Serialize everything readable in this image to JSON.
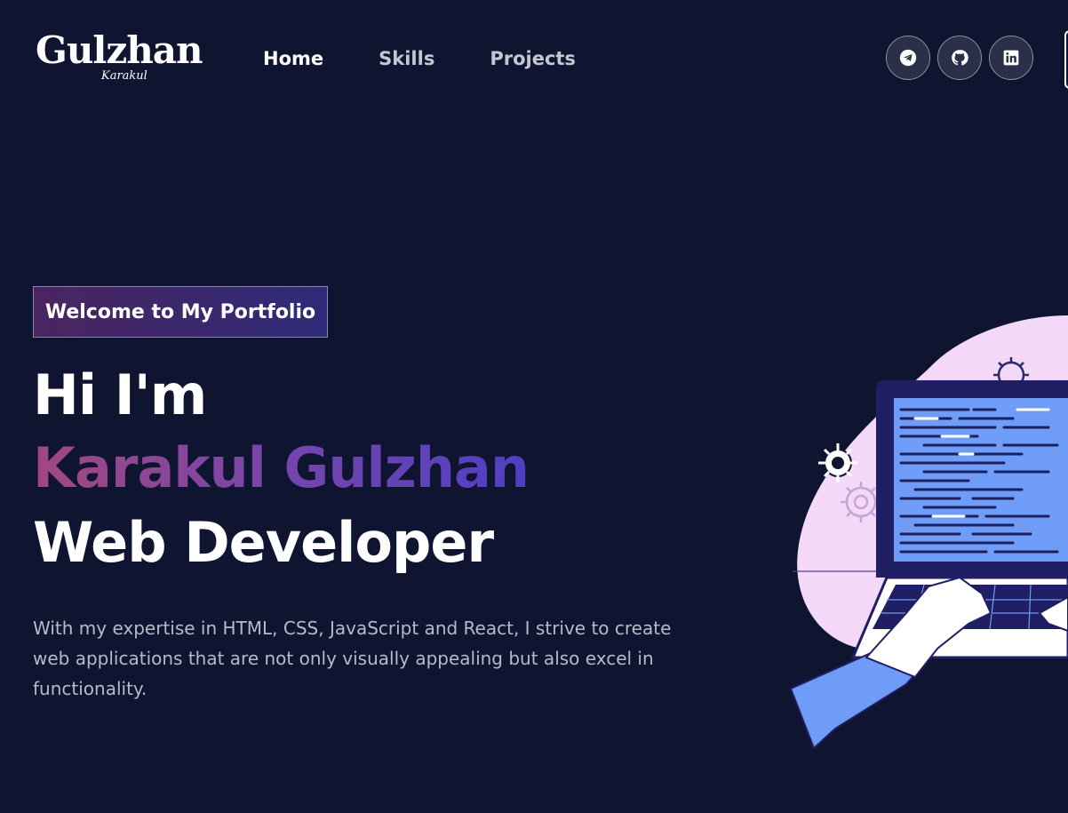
{
  "brand": {
    "logo_main": "Gulzhan",
    "logo_sub": "Karakul"
  },
  "nav": {
    "items": [
      {
        "label": "Home",
        "active": true
      },
      {
        "label": "Skills",
        "active": false
      },
      {
        "label": "Projects",
        "active": false
      }
    ]
  },
  "socials": [
    {
      "icon": "telegram-icon"
    },
    {
      "icon": "github-icon"
    },
    {
      "icon": "linkedin-icon"
    }
  ],
  "hero": {
    "tagline": "Welcome to My Portfolio",
    "line1": "Hi I'm",
    "line2": "Karakul Gulzhan",
    "line3": "Web Developer",
    "description": "With my expertise in HTML, CSS, JavaScript and React, I strive to create web applications that are not only visually appealing but also excel in functionality."
  },
  "colors": {
    "background": "#0f1530",
    "accent_gradient_start": "#a2487f",
    "accent_gradient_end": "#4f3fc4",
    "illustration_blob": "#f3d9f7",
    "screen": "#6f9cf6"
  }
}
